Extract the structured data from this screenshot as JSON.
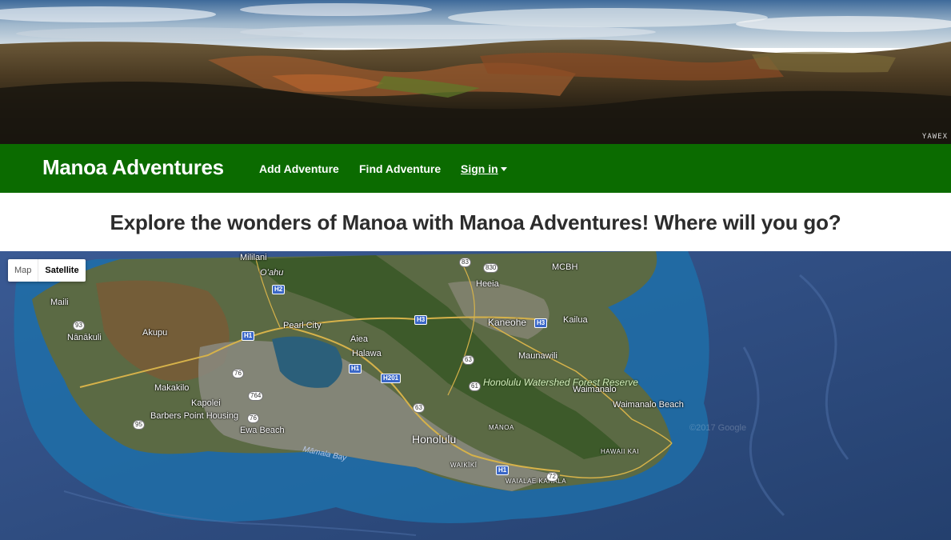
{
  "hero": {
    "watermark": "YAWEX"
  },
  "navbar": {
    "brand": "Manoa Adventures",
    "links": [
      {
        "label": "Add Adventure"
      },
      {
        "label": "Find Adventure"
      },
      {
        "label": "Sign in"
      }
    ],
    "colors": {
      "background": "#0b6b00",
      "text": "#ffffff"
    }
  },
  "headline": "Explore the wonders of Manoa with Manoa Adventures! Where will you go?",
  "map": {
    "type_control": {
      "options": [
        "Map",
        "Satellite"
      ],
      "selected": "Satellite"
    },
    "places": [
      "Mililani",
      "Oʻahu",
      "Maili",
      "Nānākuli",
      "Akupu",
      "Pearl City",
      "Aiea",
      "Halawa",
      "Kaneohe",
      "Kailua",
      "Heeia",
      "MCBH",
      "Maunawili",
      "Makakilo",
      "Kapolei",
      "Barbers Point Housing",
      "Ewa Beach",
      "Honolulu",
      "MĀNOA",
      "WAIKĪKĪ",
      "WAIALAE KAHALA",
      "Waimanalo",
      "Waimanalo Beach",
      "HAWAII KAI"
    ],
    "park": "Honolulu Watershed Forest Reserve",
    "water": "Māmala Bay",
    "highways": [
      "H1",
      "H2",
      "H3",
      "H201"
    ],
    "routes": [
      "83",
      "830",
      "93",
      "76",
      "764",
      "95",
      "63",
      "61",
      "72"
    ],
    "copyright": "©2017 Google"
  }
}
